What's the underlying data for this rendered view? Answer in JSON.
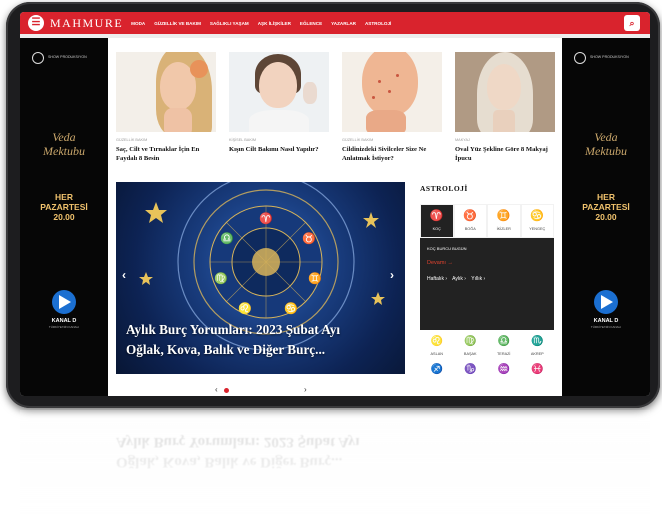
{
  "nav": {
    "logo": "MAHMURE",
    "menu_icon": "menu-icon",
    "links": [
      "MODA",
      "GÜZELLİK VE BAKIM",
      "SAĞLIKLI YAŞAM",
      "AŞK İLİŞKİLER",
      "EĞLENCE",
      "YAZARLAR",
      "ASTROLOJİ"
    ],
    "search_icon": "search-icon"
  },
  "side_ad": {
    "badge": "SHOW PRODUKSIYON",
    "title_line1": "Veda",
    "title_line2": "Mektubu",
    "day_line1": "HER",
    "day_line2": "PAZARTESİ",
    "time": "20.00",
    "channel": "KANAL D",
    "channel_sub": "TÜRKİYE'NİN KANALI"
  },
  "cards": [
    {
      "category": "GÜZELLİK BAKIM",
      "title": "Saç, Cilt ve Tırnaklar İçin En Faydalı 8 Besin"
    },
    {
      "category": "KİŞİSEL BAKIM",
      "title": "Kışın Cilt Bakımı Nasıl Yapılır?"
    },
    {
      "category": "GÜZELLİK BAKIM",
      "title": "Cildinizdeki Sivilceler Size Ne Anlatmak İstiyor?"
    },
    {
      "category": "MAKYAJ",
      "title": "Oval Yüz Şekline Göre 8 Makyaj İpucu"
    }
  ],
  "hero": {
    "caption_line1": "Aylık Burç Yorumları: 2023 Şubat Ayı",
    "caption_line2": "Oğlak, Kova, Balık ve Diğer Burç...",
    "prev": "‹",
    "next": "›"
  },
  "pager": {
    "prev": "‹",
    "next": "›"
  },
  "astrology": {
    "heading": "ASTROLOJİ",
    "tabs": [
      {
        "symbol": "♈",
        "label": "KOÇ",
        "active": true
      },
      {
        "symbol": "♉",
        "label": "BOĞA",
        "active": false
      },
      {
        "symbol": "♊",
        "label": "İKİZLER",
        "active": false
      },
      {
        "symbol": "♋",
        "label": "YENGEÇ",
        "active": false
      }
    ],
    "panel": {
      "subtitle": "KOÇ BURCU BUGÜN",
      "more": "Devamı  →",
      "periods": [
        "Haftalık ›",
        "Aylık ›",
        "Yıllık ›"
      ]
    },
    "grid": [
      {
        "symbol": "♌",
        "label": "ASLAN"
      },
      {
        "symbol": "♍",
        "label": "BAŞAK"
      },
      {
        "symbol": "♎",
        "label": "TERAZİ"
      },
      {
        "symbol": "♏",
        "label": "AKREP"
      },
      {
        "symbol": "♐",
        "label": ""
      },
      {
        "symbol": "♑",
        "label": ""
      },
      {
        "symbol": "♒",
        "label": ""
      },
      {
        "symbol": "♓",
        "label": ""
      }
    ]
  },
  "colors": {
    "brand": "#d9232d",
    "dark": "#222222",
    "ad_gold": "#f0c26d"
  }
}
